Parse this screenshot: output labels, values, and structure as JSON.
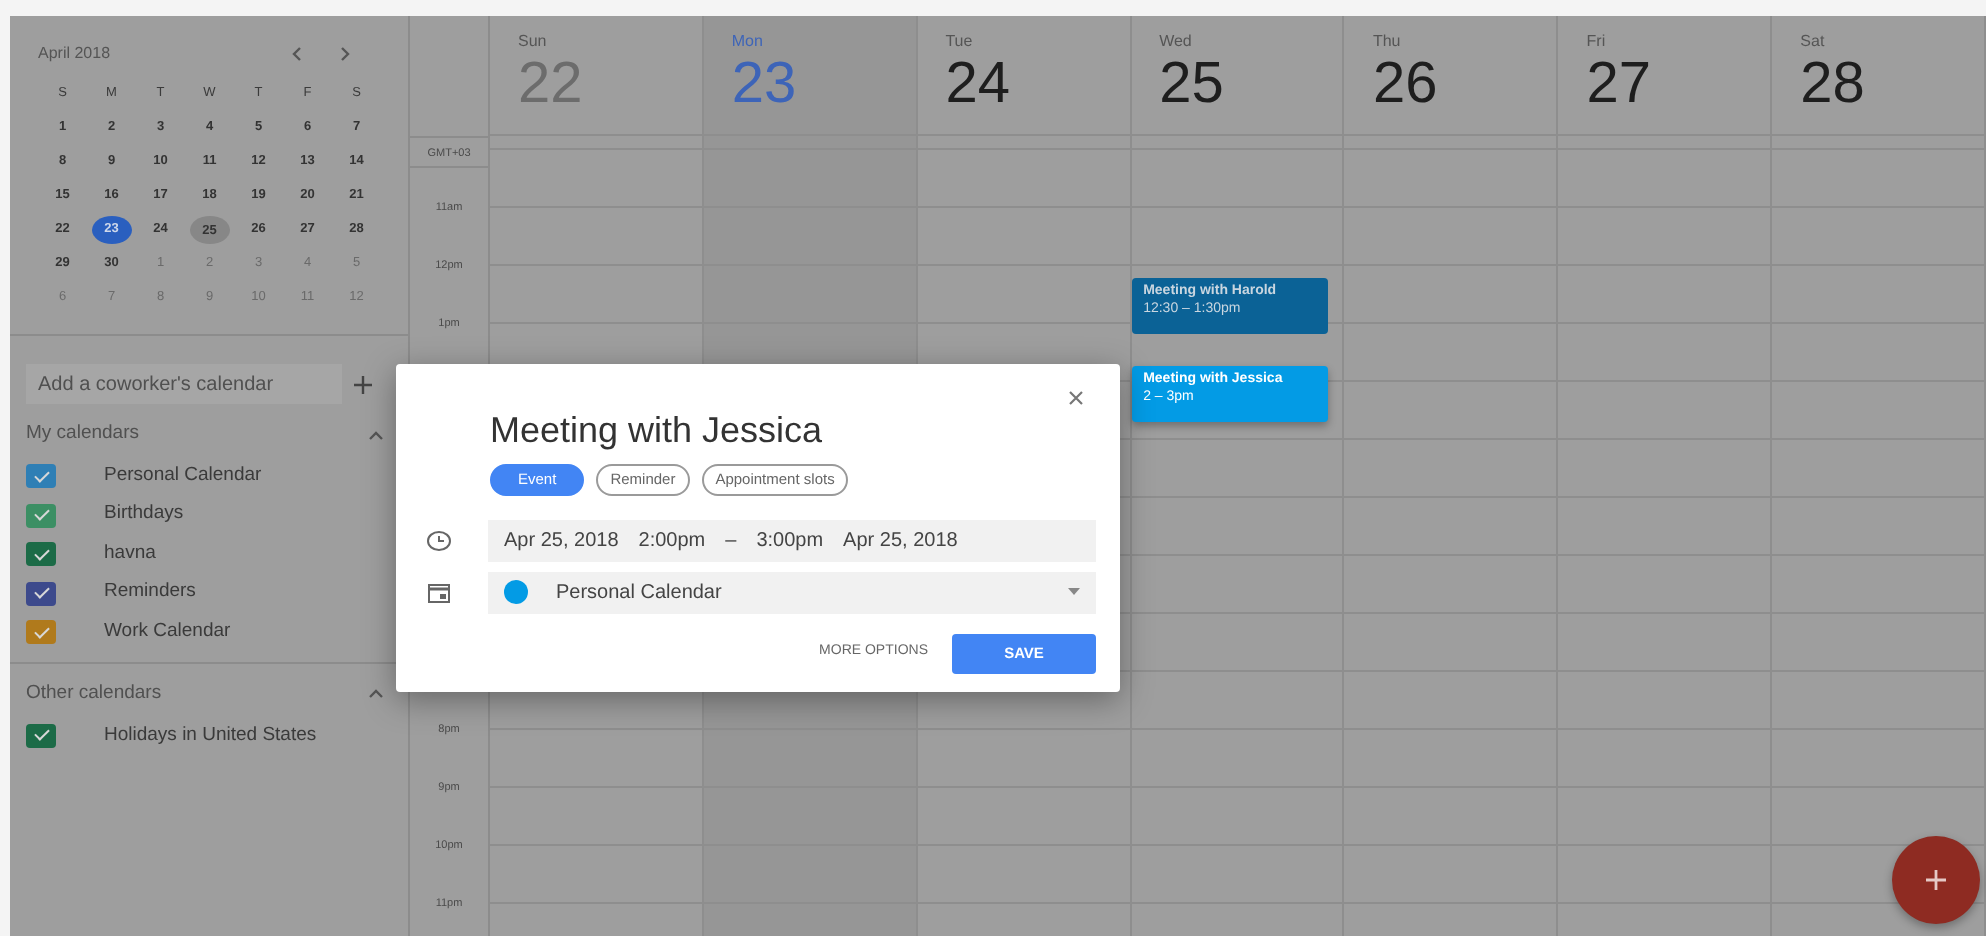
{
  "mini_calendar": {
    "month": "April 2018",
    "weekdays": [
      "S",
      "M",
      "T",
      "W",
      "T",
      "F",
      "S"
    ],
    "weeks": [
      [
        {
          "day": "1",
          "muted": false,
          "selected": false,
          "marked": false
        },
        {
          "day": "2",
          "muted": false,
          "selected": false,
          "marked": false
        },
        {
          "day": "3",
          "muted": false,
          "selected": false,
          "marked": false
        },
        {
          "day": "4",
          "muted": false,
          "selected": false,
          "marked": false
        },
        {
          "day": "5",
          "muted": false,
          "selected": false,
          "marked": false
        },
        {
          "day": "6",
          "muted": false,
          "selected": false,
          "marked": false
        },
        {
          "day": "7",
          "muted": false,
          "selected": false,
          "marked": false
        }
      ],
      [
        {
          "day": "8",
          "muted": false,
          "selected": false,
          "marked": false
        },
        {
          "day": "9",
          "muted": false,
          "selected": false,
          "marked": false
        },
        {
          "day": "10",
          "muted": false,
          "selected": false,
          "marked": false
        },
        {
          "day": "11",
          "muted": false,
          "selected": false,
          "marked": false
        },
        {
          "day": "12",
          "muted": false,
          "selected": false,
          "marked": false
        },
        {
          "day": "13",
          "muted": false,
          "selected": false,
          "marked": false
        },
        {
          "day": "14",
          "muted": false,
          "selected": false,
          "marked": false
        }
      ],
      [
        {
          "day": "15",
          "muted": false,
          "selected": false,
          "marked": false
        },
        {
          "day": "16",
          "muted": false,
          "selected": false,
          "marked": false
        },
        {
          "day": "17",
          "muted": false,
          "selected": false,
          "marked": false
        },
        {
          "day": "18",
          "muted": false,
          "selected": false,
          "marked": false
        },
        {
          "day": "19",
          "muted": false,
          "selected": false,
          "marked": false
        },
        {
          "day": "20",
          "muted": false,
          "selected": false,
          "marked": false
        },
        {
          "day": "21",
          "muted": false,
          "selected": false,
          "marked": false
        }
      ],
      [
        {
          "day": "22",
          "muted": false,
          "selected": false,
          "marked": false
        },
        {
          "day": "23",
          "muted": false,
          "selected": true,
          "marked": false
        },
        {
          "day": "24",
          "muted": false,
          "selected": false,
          "marked": false
        },
        {
          "day": "25",
          "muted": false,
          "selected": false,
          "marked": true
        },
        {
          "day": "26",
          "muted": false,
          "selected": false,
          "marked": false
        },
        {
          "day": "27",
          "muted": false,
          "selected": false,
          "marked": false
        },
        {
          "day": "28",
          "muted": false,
          "selected": false,
          "marked": false
        }
      ],
      [
        {
          "day": "29",
          "muted": false,
          "selected": false,
          "marked": false
        },
        {
          "day": "30",
          "muted": false,
          "selected": false,
          "marked": false
        },
        {
          "day": "1",
          "muted": true,
          "selected": false,
          "marked": false
        },
        {
          "day": "2",
          "muted": true,
          "selected": false,
          "marked": false
        },
        {
          "day": "3",
          "muted": true,
          "selected": false,
          "marked": false
        },
        {
          "day": "4",
          "muted": true,
          "selected": false,
          "marked": false
        },
        {
          "day": "5",
          "muted": true,
          "selected": false,
          "marked": false
        }
      ],
      [
        {
          "day": "6",
          "muted": true,
          "selected": false,
          "marked": false
        },
        {
          "day": "7",
          "muted": true,
          "selected": false,
          "marked": false
        },
        {
          "day": "8",
          "muted": true,
          "selected": false,
          "marked": false
        },
        {
          "day": "9",
          "muted": true,
          "selected": false,
          "marked": false
        },
        {
          "day": "10",
          "muted": true,
          "selected": false,
          "marked": false
        },
        {
          "day": "11",
          "muted": true,
          "selected": false,
          "marked": false
        },
        {
          "day": "12",
          "muted": true,
          "selected": false,
          "marked": false
        }
      ]
    ]
  },
  "add_calendar": {
    "placeholder": "Add a coworker's calendar"
  },
  "my_calendars": {
    "title": "My calendars",
    "expanded": true,
    "items": [
      {
        "name": "Personal Calendar",
        "color": "#2f7fb5",
        "checked": true
      },
      {
        "name": "Birthdays",
        "color": "#3c8f64",
        "checked": true
      },
      {
        "name": "havna",
        "color": "#1c6b47",
        "checked": true
      },
      {
        "name": "Reminders",
        "color": "#3d4a8c",
        "checked": true
      },
      {
        "name": "Work Calendar",
        "color": "#b07a1c",
        "checked": true
      }
    ]
  },
  "other_calendars": {
    "title": "Other calendars",
    "expanded": true,
    "items": [
      {
        "name": "Holidays in United States",
        "color": "#1c6b47",
        "checked": true
      }
    ]
  },
  "days": [
    {
      "weekday": "Sun",
      "date": "22",
      "past": true,
      "selected": false
    },
    {
      "weekday": "Mon",
      "date": "23",
      "past": false,
      "selected": true
    },
    {
      "weekday": "Tue",
      "date": "24",
      "past": false,
      "selected": false
    },
    {
      "weekday": "Wed",
      "date": "25",
      "past": false,
      "selected": false
    },
    {
      "weekday": "Thu",
      "date": "26",
      "past": false,
      "selected": false
    },
    {
      "weekday": "Fri",
      "date": "27",
      "past": false,
      "selected": false
    },
    {
      "weekday": "Sat",
      "date": "28",
      "past": false,
      "selected": false
    }
  ],
  "timezone": "GMT+03",
  "hours_top": [
    "11am",
    "12pm",
    "1pm"
  ],
  "hours_bottom": [
    "8pm",
    "9pm",
    "10pm",
    "11pm"
  ],
  "events": [
    {
      "title": "Meeting with Harold",
      "time": "12:30 – 1:30pm",
      "color": "#0b6296",
      "focused": false
    },
    {
      "title": "Meeting with Jessica",
      "time": "2 – 3pm",
      "color": "#039be5",
      "focused": true
    }
  ],
  "dialog": {
    "title": "Meeting with Jessica",
    "types": [
      {
        "label": "Event",
        "selected": true
      },
      {
        "label": "Reminder",
        "selected": false
      },
      {
        "label": "Appointment slots",
        "selected": false
      }
    ],
    "start_date": "Apr 25, 2018",
    "start_time": "2:00pm",
    "dash": "–",
    "end_time": "3:00pm",
    "end_date": "Apr 25, 2018",
    "calendar": {
      "name": "Personal Calendar",
      "color": "#039be5"
    },
    "more_options": "MORE OPTIONS",
    "save": "SAVE"
  }
}
